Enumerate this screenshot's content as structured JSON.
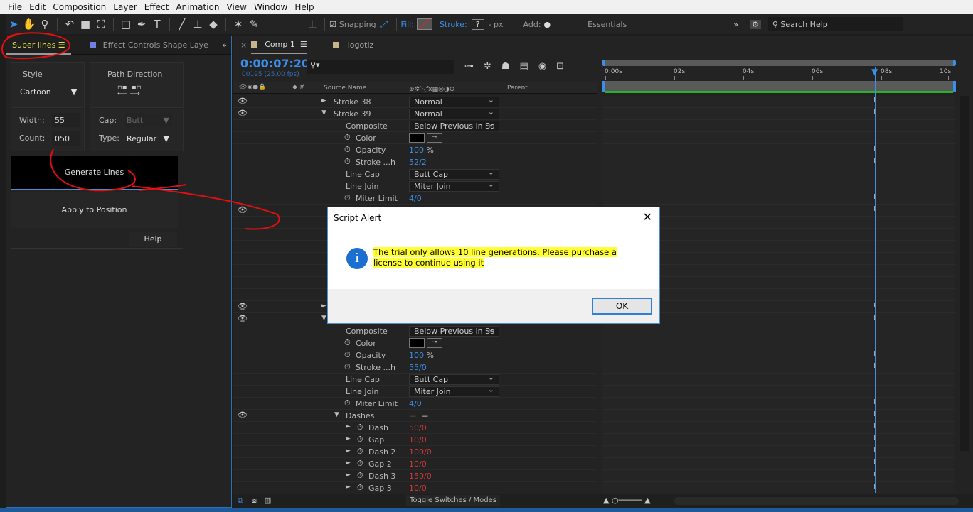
{
  "menu": [
    "File",
    "Edit",
    "Composition",
    "Layer",
    "Effect",
    "Animation",
    "View",
    "Window",
    "Help"
  ],
  "toolbar": {
    "snapping": "Snapping",
    "fill": "Fill:",
    "stroke": "Stroke:",
    "stroke_val": "?",
    "px": "- px",
    "add": "Add:",
    "workspace": "Essentials",
    "search_placeholder": "Search Help"
  },
  "left_panel": {
    "tab_active": "Super lines",
    "tab_other": "Effect Controls Shape Laye",
    "style_label": "Style",
    "style_value": "Cartoon",
    "path_direction": "Path Direction",
    "width_label": "Width:",
    "width_value": "55",
    "count_label": "Count:",
    "count_value": "050",
    "cap_label": "Cap:",
    "cap_value": "Butt",
    "type_label": "Type:",
    "type_value": "Regular",
    "generate": "Generate Lines",
    "apply": "Apply to Position",
    "help": "Help"
  },
  "timeline": {
    "tab_comp": "Comp 1",
    "tab_other": "logotiz",
    "timecode": "0:00:07:20",
    "frames": "00195 (25.00 fps)",
    "source_name": "Source Name",
    "parent": "Parent",
    "ruler": [
      "0:00s",
      "02s",
      "04s",
      "06s",
      "08s",
      "10s"
    ],
    "toggle": "Toggle Switches / Modes",
    "work_area_color": "#2ab32a",
    "playhead_color": "#3b8fe8",
    "rows": [
      {
        "eye": true,
        "tw": "►",
        "name": "Stroke 38",
        "dd": "Normal",
        "lvl": 0
      },
      {
        "eye": true,
        "tw": "▼",
        "name": "Stroke 39",
        "dd": "Normal",
        "lvl": 0
      },
      {
        "name": "Composite",
        "dd": "Below Previous in Sa",
        "lvl": 1
      },
      {
        "sw": true,
        "name": "Color",
        "color": true,
        "lvl": 1
      },
      {
        "sw": true,
        "name": "Opacity",
        "val": "100",
        "unit": "%",
        "vc": "blue",
        "lvl": 1
      },
      {
        "sw": true,
        "name": "Stroke ...h",
        "val": "52/2",
        "vc": "blue",
        "lvl": 1
      },
      {
        "name": "Line Cap",
        "dd": "Butt Cap",
        "lvl": 1
      },
      {
        "name": "Line Join",
        "dd": "Miter Join",
        "lvl": 1
      },
      {
        "sw": true,
        "name": "Miter Limit",
        "val": "4/0",
        "vc": "blue",
        "lvl": 1
      },
      {
        "eye": true
      },
      {},
      {},
      {},
      {},
      {},
      {},
      {},
      {
        "eye": true,
        "tw": "►"
      },
      {
        "eye": true,
        "tw": "▼"
      },
      {
        "name": "Composite",
        "dd": "Below Previous in Sa",
        "lvl": 1
      },
      {
        "sw": true,
        "name": "Color",
        "color": true,
        "lvl": 1
      },
      {
        "sw": true,
        "name": "Opacity",
        "val": "100",
        "unit": "%",
        "vc": "blue",
        "lvl": 1
      },
      {
        "sw": true,
        "name": "Stroke ...h",
        "val": "55/0",
        "vc": "blue",
        "lvl": 1
      },
      {
        "name": "Line Cap",
        "dd": "Butt Cap",
        "lvl": 1
      },
      {
        "name": "Line Join",
        "dd": "Miter Join",
        "lvl": 1
      },
      {
        "sw": true,
        "name": "Miter Limit",
        "val": "4/0",
        "vc": "blue",
        "lvl": 1
      },
      {
        "eye": true,
        "tw": "▼",
        "name": "Dashes",
        "pm": true,
        "lvl": 1
      },
      {
        "tw": "►",
        "sw": true,
        "name": "Dash",
        "val": "50/0",
        "vc": "red",
        "lvl": 2
      },
      {
        "tw": "►",
        "sw": true,
        "name": "Gap",
        "val": "10/0",
        "vc": "red",
        "lvl": 2
      },
      {
        "tw": "►",
        "sw": true,
        "name": "Dash 2",
        "val": "100/0",
        "vc": "red",
        "lvl": 2
      },
      {
        "tw": "►",
        "sw": true,
        "name": "Gap 2",
        "val": "10/0",
        "vc": "red",
        "lvl": 2
      },
      {
        "tw": "►",
        "sw": true,
        "name": "Dash 3",
        "val": "150/0",
        "vc": "red",
        "lvl": 2
      },
      {
        "tw": "►",
        "sw": true,
        "name": "Gap 3",
        "val": "10/0",
        "vc": "red",
        "lvl": 2
      }
    ]
  },
  "dialog": {
    "title": "Script Alert",
    "message": "The trial only allows 10 line generations. Please purchase a license to continue using it",
    "ok": "OK",
    "highlight": "#ffff33"
  }
}
